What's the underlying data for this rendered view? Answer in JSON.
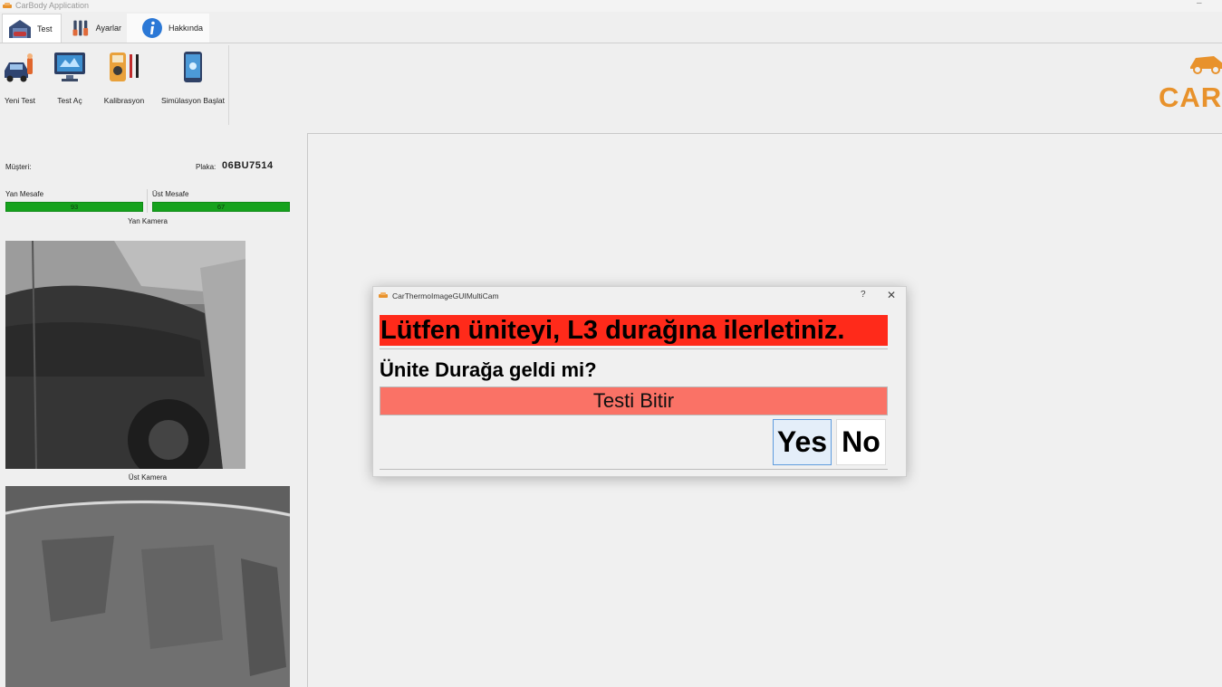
{
  "window": {
    "title": "CarBody Application",
    "minimize_glyph": "–"
  },
  "tabs": [
    {
      "label": "Test",
      "icon": "garage-icon"
    },
    {
      "label": "Ayarlar",
      "icon": "tools-icon"
    },
    {
      "label": "Hakkında",
      "icon": "info-icon"
    }
  ],
  "ribbon": [
    {
      "label": "Yeni Test",
      "icon": "new-test-icon"
    },
    {
      "label": "Test Aç",
      "icon": "open-test-icon"
    },
    {
      "label": "Kalibrasyon",
      "icon": "multimeter-icon"
    },
    {
      "label": "Simülasyon Başlat",
      "icon": "phone-simulation-icon"
    }
  ],
  "brand": {
    "text": "CARM",
    "color": "#e8922c"
  },
  "info": {
    "customer_label": "Müşteri:",
    "customer_value": "",
    "plate_label": "Plaka:",
    "plate_value": "06BU7514"
  },
  "distances": {
    "side_label": "Yan Mesafe",
    "side_value": "93",
    "top_label": "Üst Mesafe",
    "top_value": "67"
  },
  "cameras": {
    "side_caption": "Yan Kamera",
    "top_caption": "Üst Kamera"
  },
  "dialog": {
    "title": "CarThermoImageGUIMultiCam",
    "help_glyph": "?",
    "close_glyph": "✕",
    "message": "Lütfen üniteyi, L3 durağına ilerletiniz.",
    "question": "Ünite Durağa geldi mi?",
    "finish_label": "Testi Bitir",
    "yes_label": "Yes",
    "no_label": "No"
  },
  "colors": {
    "alert_red": "#ff2a1a",
    "finish_salmon": "#fa7266",
    "progress_green": "#16a21d",
    "brand_orange": "#e8922c"
  }
}
